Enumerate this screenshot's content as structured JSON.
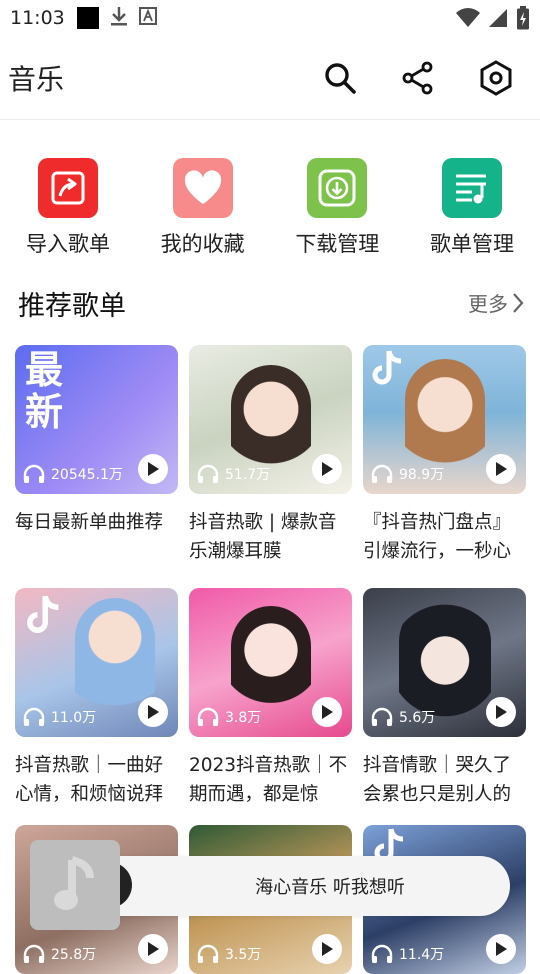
{
  "status_bar": {
    "time": "11:03"
  },
  "app_bar": {
    "title": "音乐"
  },
  "quick_actions": [
    {
      "label": "导入歌单",
      "color": "#f02b2b",
      "icon": "import-icon"
    },
    {
      "label": "我的收藏",
      "color": "#f78b8b",
      "icon": "heart-icon"
    },
    {
      "label": "下载管理",
      "color": "#7dc24a",
      "icon": "download-icon"
    },
    {
      "label": "歌单管理",
      "color": "#14b38a",
      "icon": "playlist-icon"
    }
  ],
  "section": {
    "title": "推荐歌单",
    "more": "更多"
  },
  "cards": [
    {
      "title": "每日最新单曲推荐",
      "count": "20545.1万",
      "cover_text": "最\n新",
      "bg": "linear-gradient(135deg,#5b6cf0,#a08cf5 60%,#c3b9f4)"
    },
    {
      "title": "抖音热歌 | 爆款音乐潮爆耳膜",
      "count": "51.7万",
      "bg": "linear-gradient(160deg,#e9ece3,#c9d3c0 50%,#f4f1e9)"
    },
    {
      "title": "『抖音热门盘点』引爆流行，一秒心",
      "count": "98.9万",
      "bg": "linear-gradient(180deg,#9fc8e8,#7fb4d8 45%,#e8d6cc)"
    },
    {
      "title": "抖音热歌｜一曲好心情，和烦恼说拜",
      "count": "11.0万",
      "bg": "linear-gradient(160deg,#f2b8c2,#a8c5e8 55%,#6f86b8)"
    },
    {
      "title": "2023抖音热歌｜不期而遇，都是惊",
      "count": "3.8万",
      "bg": "linear-gradient(160deg,#f05aa8,#f7a3cc 50%,#e64a8e)"
    },
    {
      "title": "抖音情歌｜哭久了会累也只是别人的",
      "count": "5.6万",
      "bg": "linear-gradient(160deg,#3a3f4a,#6f7686 50%,#2b2f38)"
    },
    {
      "title": "",
      "count": "25.8万",
      "bg": "linear-gradient(160deg,#cfa79a,#8e6f62 60%,#e9d5cd)"
    },
    {
      "title": "",
      "count": "3.5万",
      "bg": "linear-gradient(160deg,#2f5a35,#c39a5c 50%,#e8d2b0)"
    },
    {
      "title": "",
      "count": "11.4万",
      "bg": "linear-gradient(160deg,#7ca0d8,#2d3f66 55%,#c2cfe5)"
    }
  ],
  "player": {
    "text": "海心音乐 听我想听"
  }
}
